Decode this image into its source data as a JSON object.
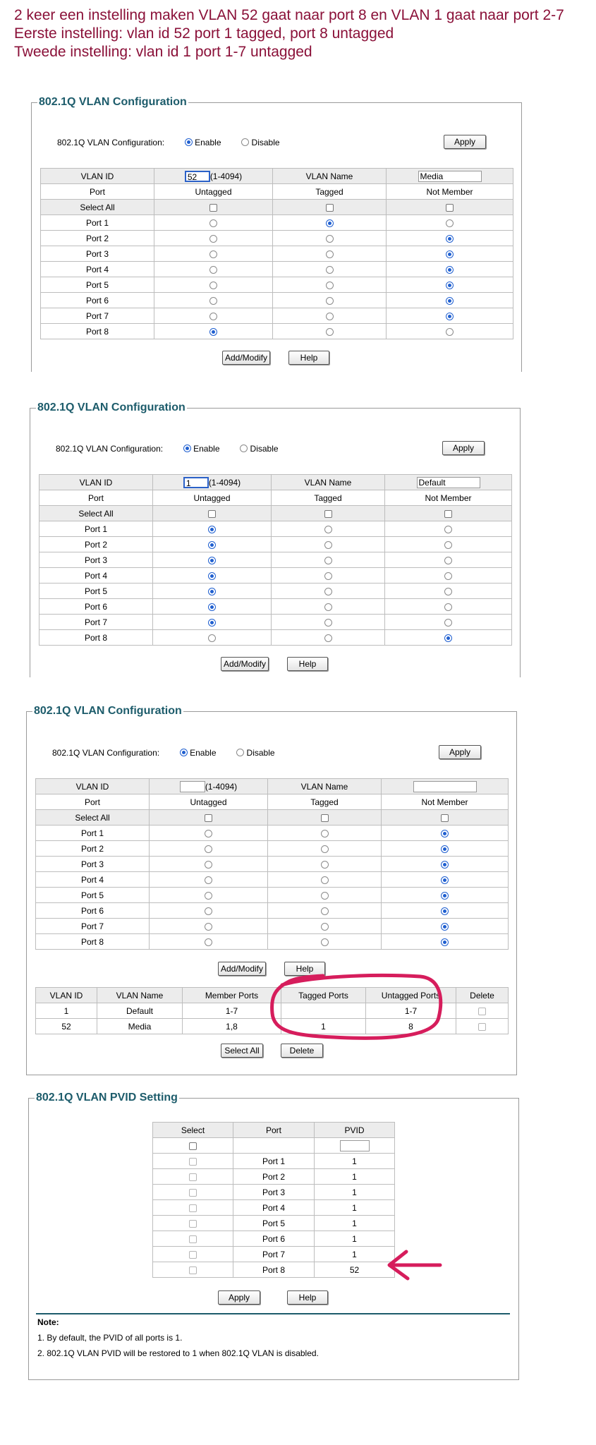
{
  "header": {
    "line1": "2 keer een instelling maken VLAN 52 gaat naar port 8 en VLAN 1 gaat naar port 2-7",
    "line2": "Eerste instelling: vlan id 52 port 1 tagged, port 8 untagged",
    "line3": "Tweede instelling: vlan id 1 port 1-7 untagged"
  },
  "common": {
    "section_title": "802.1Q VLAN Configuration",
    "config_label": "802.1Q VLAN Configuration:",
    "enable_label": "Enable",
    "disable_label": "Disable",
    "apply_label": "Apply",
    "vlan_id_label": "VLAN ID",
    "vlan_id_range": "(1-4094)",
    "vlan_name_label": "VLAN Name",
    "col_port": "Port",
    "col_untagged": "Untagged",
    "col_tagged": "Tagged",
    "col_not_member": "Not Member",
    "select_all": "Select All",
    "add_modify_label": "Add/Modify",
    "help_label": "Help",
    "ports": [
      "Port 1",
      "Port 2",
      "Port 3",
      "Port 4",
      "Port 5",
      "Port 6",
      "Port 7",
      "Port 8"
    ]
  },
  "configs": [
    {
      "vlan_id": "52",
      "vlan_name": "Media",
      "membership": [
        "tagged",
        "not_member",
        "not_member",
        "not_member",
        "not_member",
        "not_member",
        "not_member",
        "untagged"
      ]
    },
    {
      "vlan_id": "1",
      "vlan_name": "Default",
      "membership": [
        "untagged",
        "untagged",
        "untagged",
        "untagged",
        "untagged",
        "untagged",
        "untagged",
        "not_member"
      ]
    },
    {
      "vlan_id": "",
      "vlan_name": "",
      "membership": [
        "not_member",
        "not_member",
        "not_member",
        "not_member",
        "not_member",
        "not_member",
        "not_member",
        "not_member"
      ]
    }
  ],
  "vlan_list": {
    "headers": [
      "VLAN ID",
      "VLAN Name",
      "Member Ports",
      "Tagged Ports",
      "Untagged Ports",
      "Delete"
    ],
    "rows": [
      {
        "id": "1",
        "name": "Default",
        "members": "1-7",
        "tagged": "",
        "untagged": "1-7"
      },
      {
        "id": "52",
        "name": "Media",
        "members": "1,8",
        "tagged": "1",
        "untagged": "8"
      }
    ],
    "select_all_label": "Select All",
    "delete_label": "Delete"
  },
  "pvid": {
    "section_title": "802.1Q VLAN PVID Setting",
    "col_select": "Select",
    "col_port": "Port",
    "col_pvid": "PVID",
    "rows": [
      {
        "port": "Port 1",
        "pvid": "1"
      },
      {
        "port": "Port 2",
        "pvid": "1"
      },
      {
        "port": "Port 3",
        "pvid": "1"
      },
      {
        "port": "Port 4",
        "pvid": "1"
      },
      {
        "port": "Port 5",
        "pvid": "1"
      },
      {
        "port": "Port 6",
        "pvid": "1"
      },
      {
        "port": "Port 7",
        "pvid": "1"
      },
      {
        "port": "Port 8",
        "pvid": "52"
      }
    ],
    "apply_label": "Apply",
    "help_label": "Help"
  },
  "note": {
    "title": "Note:",
    "line1": "1. By default, the PVID of all ports is 1.",
    "line2": "2. 802.1Q VLAN PVID will be restored to 1 when 802.1Q VLAN is disabled."
  },
  "colors": {
    "header_text": "#8a1038",
    "legend": "#1d5c6b",
    "radio": "#1f5fd0",
    "annotation": "#d61d5c"
  }
}
